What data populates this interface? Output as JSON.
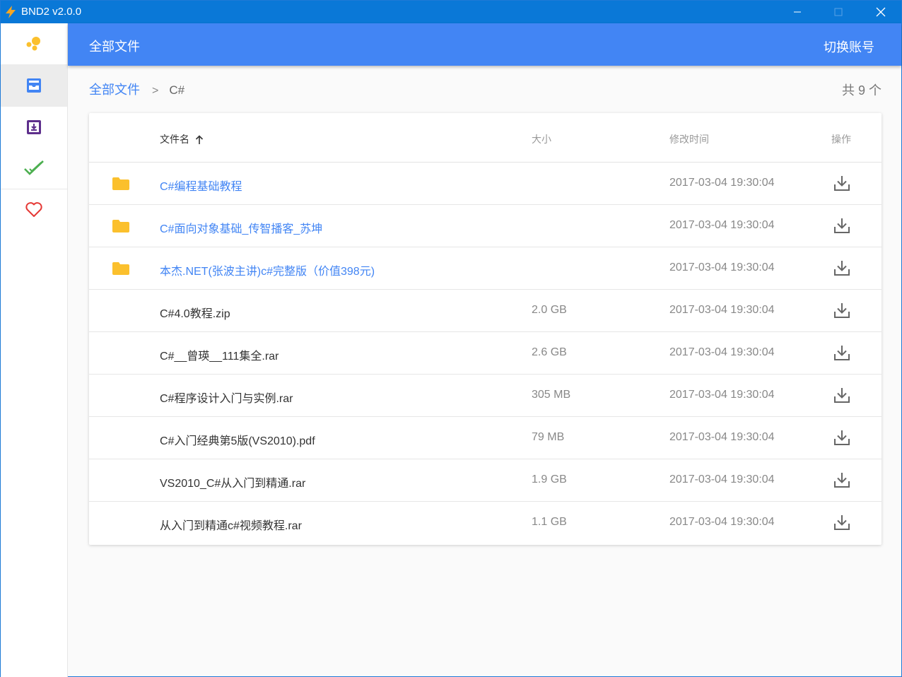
{
  "window": {
    "title": "BND2 v2.0.0"
  },
  "colors": {
    "titlebar": "#0a78d7",
    "accent": "#4285f4",
    "folder": "#fbc02d",
    "done": "#4caf50",
    "favorite": "#e53935",
    "download_icon": "#5e2f8c"
  },
  "sidebar": {
    "items": [
      {
        "icon": "logo-icon"
      },
      {
        "icon": "file-tray-icon"
      },
      {
        "icon": "download-box-icon"
      },
      {
        "icon": "check-icon"
      },
      {
        "icon": "heart-icon"
      }
    ]
  },
  "header": {
    "title": "全部文件",
    "switch_account": "切换账号"
  },
  "breadcrumb": {
    "root": "全部文件",
    "separator": ">",
    "current": "C#"
  },
  "count_label": "共 9 个",
  "table": {
    "columns": {
      "name": "文件名",
      "size": "大小",
      "modified": "修改时间",
      "action": "操作"
    },
    "rows": [
      {
        "name": "C#编程基础教程",
        "size": "",
        "modified": "2017-03-04 19:30:04",
        "is_dir": true
      },
      {
        "name": "C#面向对象基础_传智播客_苏坤",
        "size": "",
        "modified": "2017-03-04 19:30:04",
        "is_dir": true
      },
      {
        "name": "本杰.NET(张波主讲)c#完整版（价值398元)",
        "size": "",
        "modified": "2017-03-04 19:30:04",
        "is_dir": true
      },
      {
        "name": "C#4.0教程.zip",
        "size": "2.0 GB",
        "modified": "2017-03-04 19:30:04",
        "is_dir": false
      },
      {
        "name": "C#__曾瑛__111集全.rar",
        "size": "2.6 GB",
        "modified": "2017-03-04 19:30:04",
        "is_dir": false
      },
      {
        "name": "C#程序设计入门与实例.rar",
        "size": "305 MB",
        "modified": "2017-03-04 19:30:04",
        "is_dir": false
      },
      {
        "name": "C#入门经典第5版(VS2010).pdf",
        "size": "79 MB",
        "modified": "2017-03-04 19:30:04",
        "is_dir": false
      },
      {
        "name": "VS2010_C#从入门到精通.rar",
        "size": "1.9 GB",
        "modified": "2017-03-04 19:30:04",
        "is_dir": false
      },
      {
        "name": "从入门到精通c#视频教程.rar",
        "size": "1.1 GB",
        "modified": "2017-03-04 19:30:04",
        "is_dir": false
      }
    ]
  }
}
